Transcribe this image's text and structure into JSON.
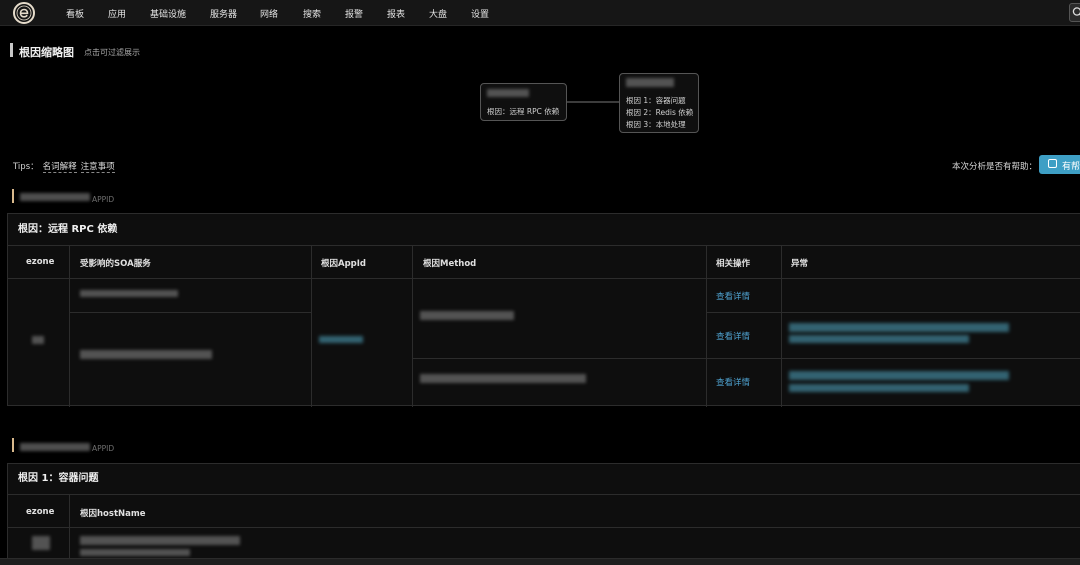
{
  "nav": {
    "items": [
      "看板",
      "应用",
      "基础设施",
      "服务器",
      "网络",
      "搜索",
      "报警",
      "报表",
      "大盘",
      "设置"
    ]
  },
  "overview": {
    "title": "根因缩略图",
    "subtitle": "点击可过滤展示",
    "node_left": {
      "lines": [
        "根因：远程 RPC 依赖"
      ]
    },
    "node_right": {
      "lines": [
        "根因 1：容器问题",
        "根因 2：Redis 依赖",
        "根因 3：本地处理"
      ]
    }
  },
  "tips": {
    "label": "Tips：",
    "links": [
      "名词解释",
      "注意事项"
    ]
  },
  "feedback": {
    "question": "本次分析是否有帮助：",
    "button_label": "有帮"
  },
  "appid_label": "APPID",
  "panel1": {
    "title": "根因：远程 RPC 依赖",
    "columns": [
      "ezone",
      "受影响的SOA服务",
      "根因AppId",
      "根因Method",
      "相关操作",
      "异常"
    ],
    "actions": [
      "查看详情",
      "查看详情",
      "查看详情"
    ]
  },
  "panel2": {
    "title": "根因 1：容器问题",
    "columns": [
      "ezone",
      "根因hostName"
    ]
  },
  "colors": {
    "accent": "#3e9fc5",
    "link": "#4fa3d1",
    "appid_marker": "#d9b98c"
  }
}
